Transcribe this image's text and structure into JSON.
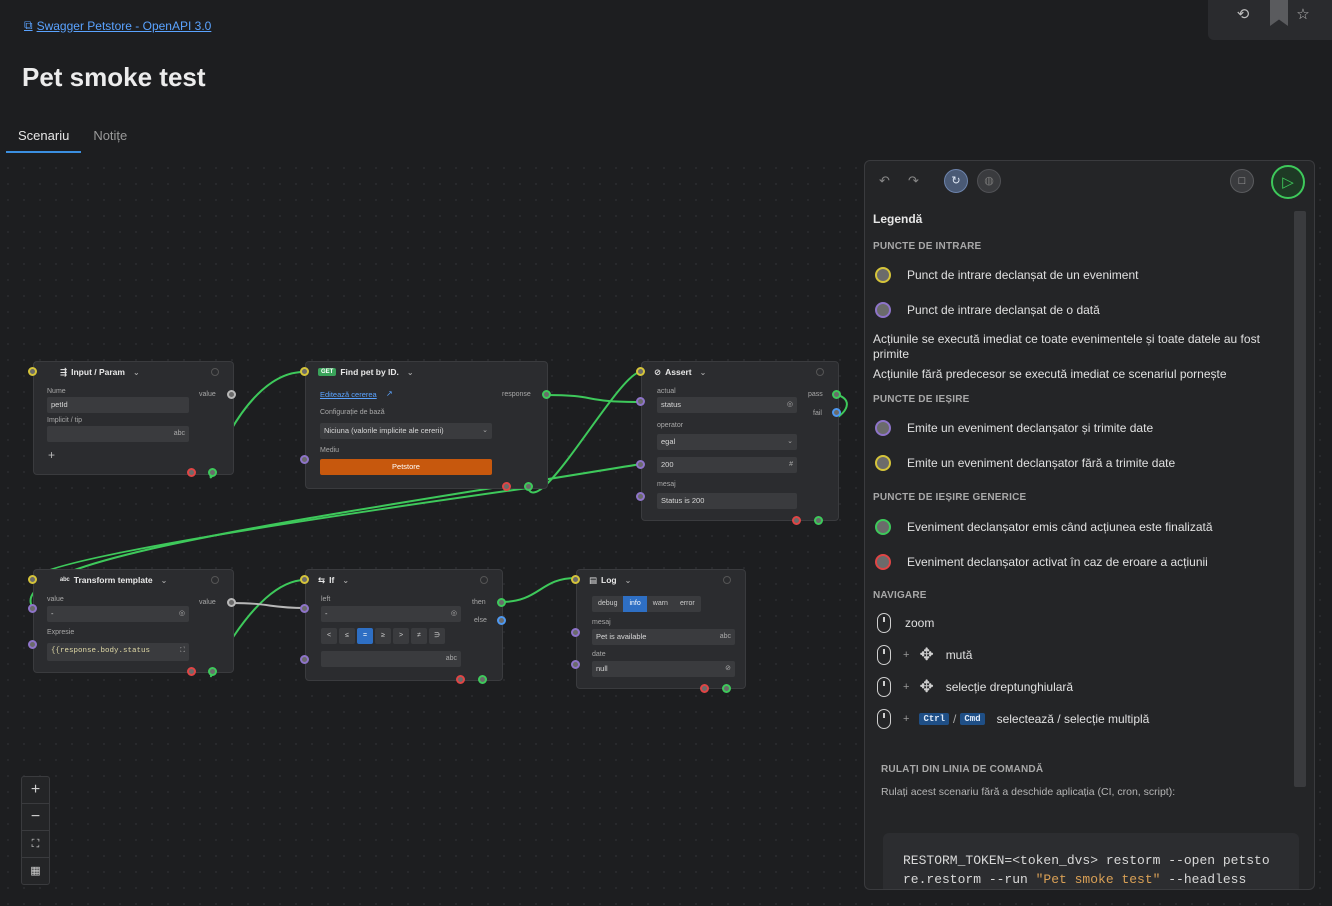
{
  "breadcrumb": {
    "label": "Swagger Petstore - OpenAPI 3.0"
  },
  "page": {
    "title": "Pet smoke test"
  },
  "tabs": [
    {
      "label": "Scenariu"
    },
    {
      "label": "Notițe"
    }
  ],
  "nodes": {
    "input": {
      "title": "Input / Param",
      "name_label": "Nume",
      "name_value": "petId",
      "default_label": "Implicit / tip",
      "type_suffix": "abc",
      "port_value": "value"
    },
    "find": {
      "method": "GET",
      "title": "Find pet by ID.",
      "edit_link": "Editează cererea",
      "base_label": "Configurație de bază",
      "base_value": "Niciuna (valorile implicite ale cererii)",
      "env_label": "Mediu",
      "env_value": "Petstore",
      "port_response": "response"
    },
    "assert": {
      "title": "Assert",
      "actual_label": "actual",
      "actual_value": "status",
      "operator_label": "operator",
      "operator_value": "egal",
      "expected_value": "200",
      "message_label": "mesaj",
      "message_value": "Status is 200",
      "port_pass": "pass",
      "port_fail": "fail"
    },
    "transform": {
      "title": "Transform template",
      "value_label": "value",
      "expr_label": "Expresie",
      "expr_value": "{{response.body.status",
      "port_value": "value"
    },
    "if": {
      "title": "If",
      "left_label": "left",
      "left_value": "-",
      "ops": [
        "<",
        "≤",
        "=",
        "≥",
        ">",
        "≠",
        "∋"
      ],
      "right_suffix": "abc",
      "port_then": "then",
      "port_else": "else"
    },
    "log": {
      "title": "Log",
      "levels": [
        "debug",
        "info",
        "warn",
        "error"
      ],
      "active_level": "info",
      "message_label": "mesaj",
      "message_value": "Pet is available",
      "msg_suffix": "abc",
      "data_label": "date",
      "data_value": "null"
    }
  },
  "zoom": {
    "in": "+",
    "out": "−"
  },
  "panel": {
    "legend_title": "Legendă",
    "entry_section": "PUNCTE DE INTRARE",
    "entry_event": "Punct de intrare declanșat de un eveniment",
    "entry_data": "Punct de intrare declanșat de o dată",
    "note1": "Acțiunile se execută imediat ce toate evenimentele și toate datele au fost primite",
    "note2": "Acțiunile fără predecesor se execută imediat ce scenariul pornește",
    "exit_section": "PUNCTE DE IEȘIRE",
    "exit_data": "Emite un eveniment declanșator și trimite date",
    "exit_nodata": "Emite un eveniment declanșator fără a trimite date",
    "generic_section": "PUNCTE DE IEȘIRE GENERICE",
    "generic_done": "Eveniment declanșator emis când acțiunea este finalizată",
    "generic_error": "Eveniment declanșator activat în caz de eroare a acțiunii",
    "nav_section": "NAVIGARE",
    "nav_zoom": "zoom",
    "nav_move": "mută",
    "nav_rect": "selecție dreptunghiulară",
    "nav_ctrl": "Ctrl",
    "nav_slash": "/",
    "nav_cmd": "Cmd",
    "nav_multi": "selectează / selecție multiplă",
    "cli_section": "RULAȚI DIN LINIA DE COMANDĂ",
    "cli_desc": "Rulați acest scenariu fără a deschide aplicația (CI, cron, script):",
    "cli_line1": "RESTORM_TOKEN=<token_dvs> restorm --open petsto",
    "cli_line2a": "re.restorm --run ",
    "cli_line2b": "\"Pet smoke test\"",
    "cli_line2c": " --headless"
  },
  "colors": {
    "accent": "#3b8fe0",
    "run": "#3ec95b",
    "env": "#c7580d"
  }
}
